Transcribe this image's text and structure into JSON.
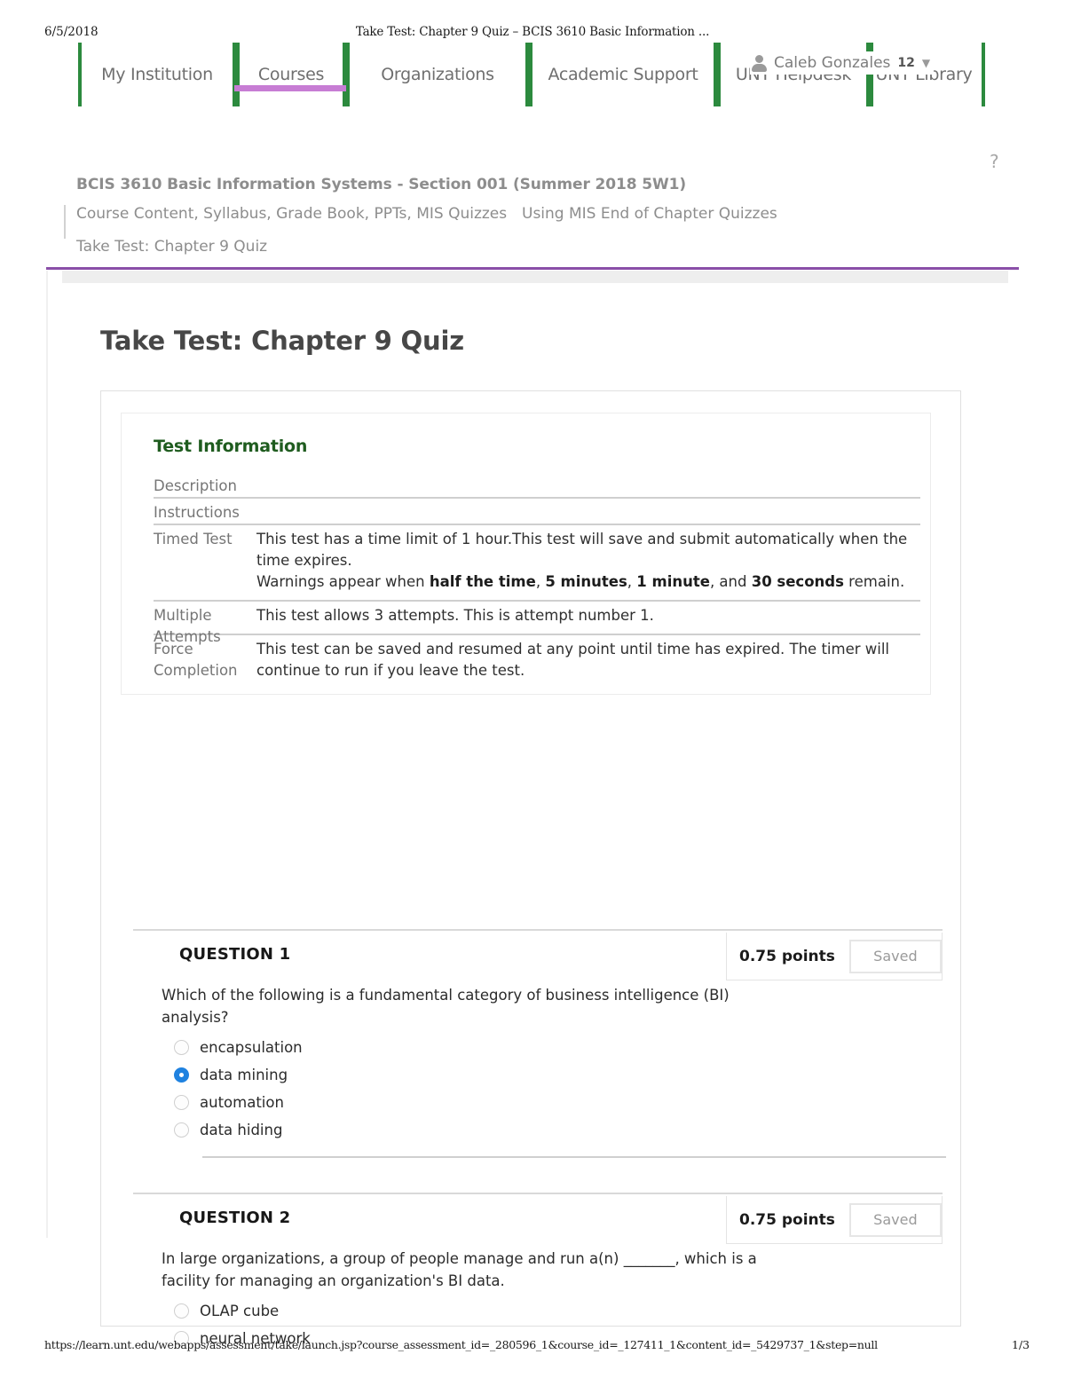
{
  "print": {
    "date": "6/5/2018",
    "doc_title": "Take Test: Chapter 9 Quiz – BCIS 3610 Basic Information ...",
    "footer_url": "https://learn.unt.edu/webapps/assessment/take/launch.jsp?course_assessment_id=_280596_1&course_id=_127411_1&content_id=_5429737_1&step=null",
    "page_number": "1/3"
  },
  "colors": {
    "tab_green": "#2c8a3e",
    "active_underline_purple": "#c77dd4",
    "divider_purple": "#8a4fa8",
    "heading_green": "#1f5c1f",
    "radio_selected_blue": "#1f82e0"
  },
  "nav": {
    "tabs": [
      {
        "label": "My Institution",
        "active": false
      },
      {
        "label": "Courses",
        "active": true
      },
      {
        "label": "Organizations",
        "active": false
      },
      {
        "label": "Academic Support",
        "active": false
      },
      {
        "label": "UNT Helpdesk",
        "active": false
      },
      {
        "label": "UNT Library",
        "active": false
      }
    ],
    "user_menu": {
      "icon": "person-icon",
      "name": "Caleb Gonzales",
      "notification_count": "12",
      "chevron": "▼"
    },
    "help_icon_label": "?"
  },
  "breadcrumb": {
    "course_title": "BCIS 3610 Basic Information Systems - Section 001 (Summer 2018 5W1)",
    "crumbs": [
      "Course Content, Syllabus, Grade Book, PPTs, MIS Quizzes",
      "Using MIS End of Chapter Quizzes"
    ],
    "current": "Take Test: Chapter 9 Quiz"
  },
  "page": {
    "title": "Take Test: Chapter 9 Quiz"
  },
  "test_information": {
    "heading": "Test Information",
    "rows": [
      {
        "label": "Description",
        "value": ""
      },
      {
        "label": "Instructions",
        "value": ""
      },
      {
        "label": "Timed Test",
        "line1": "This test has a time limit of 1 hour.This test will save and submit automatically when the time expires.",
        "line2_pre": "Warnings appear when ",
        "line2_b1": "half the time",
        "line2_s1": ", ",
        "line2_b2": "5 minutes",
        "line2_s2": ", ",
        "line2_b3": "1 minute",
        "line2_s3": ", and ",
        "line2_b4": "30 seconds",
        "line2_post": " remain."
      },
      {
        "label": "Multiple Attempts",
        "value": "This test allows 3 attempts. This is attempt number 1."
      },
      {
        "label": "Force Completion",
        "value": "This test can be saved and resumed at any point until time has expired. The timer will continue to run if you leave the test."
      }
    ]
  },
  "questions": [
    {
      "title": "QUESTION 1",
      "points": "0.75 points",
      "save_label": "Saved",
      "text": "Which of the following is a fundamental category of business intelligence (BI) analysis?",
      "options": [
        {
          "label": "encapsulation",
          "selected": false
        },
        {
          "label": "data mining",
          "selected": true
        },
        {
          "label": "automation",
          "selected": false
        },
        {
          "label": "data hiding",
          "selected": false
        }
      ]
    },
    {
      "title": "QUESTION 2",
      "points": "0.75 points",
      "save_label": "Saved",
      "text": "In large organizations, a group of people manage and run a(n) _______, which is a facility for managing an organization's BI data.",
      "options": [
        {
          "label": "OLAP cube",
          "selected": false
        },
        {
          "label": "neural network",
          "selected": false
        }
      ]
    }
  ]
}
